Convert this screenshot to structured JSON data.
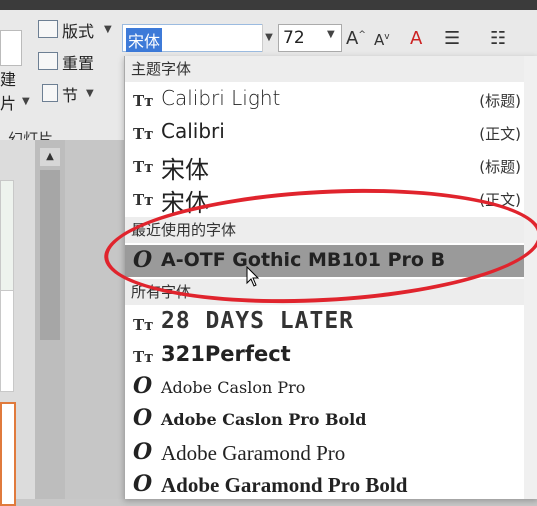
{
  "ribbon": {
    "layout_label": "版式",
    "reset_label": "重置",
    "section_label": "节",
    "new_label_partial": "建",
    "slide_label_partial": "片",
    "group_label": "幻灯片"
  },
  "font_toolbar": {
    "font_name": "宋体",
    "font_size": "72",
    "grow_label": "A",
    "shrink_label": "A"
  },
  "dropdown": {
    "sections": {
      "theme": "主题字体",
      "recent": "最近使用的字体",
      "all": "所有字体"
    },
    "theme_fonts": [
      {
        "name": "Calibri Light",
        "tag": "(标题)"
      },
      {
        "name": "Calibri",
        "tag": "(正文)"
      },
      {
        "name": "宋体",
        "tag": "(标题)"
      },
      {
        "name": "宋体",
        "tag": "(正文)"
      }
    ],
    "recent_fonts": [
      {
        "name": "A-OTF Gothic MB101 Pro B"
      }
    ],
    "all_fonts": [
      {
        "name": "28 DAYS LATER"
      },
      {
        "name": "321Perfect"
      },
      {
        "name": "Adobe Caslon Pro"
      },
      {
        "name": "Adobe Caslon Pro Bold"
      },
      {
        "name": "Adobe Garamond Pro"
      },
      {
        "name": "Adobe Garamond Pro Bold"
      }
    ]
  },
  "colors": {
    "highlight": "#9a9a9a",
    "selection": "#3d7ad8",
    "annotation": "#e0242d"
  }
}
